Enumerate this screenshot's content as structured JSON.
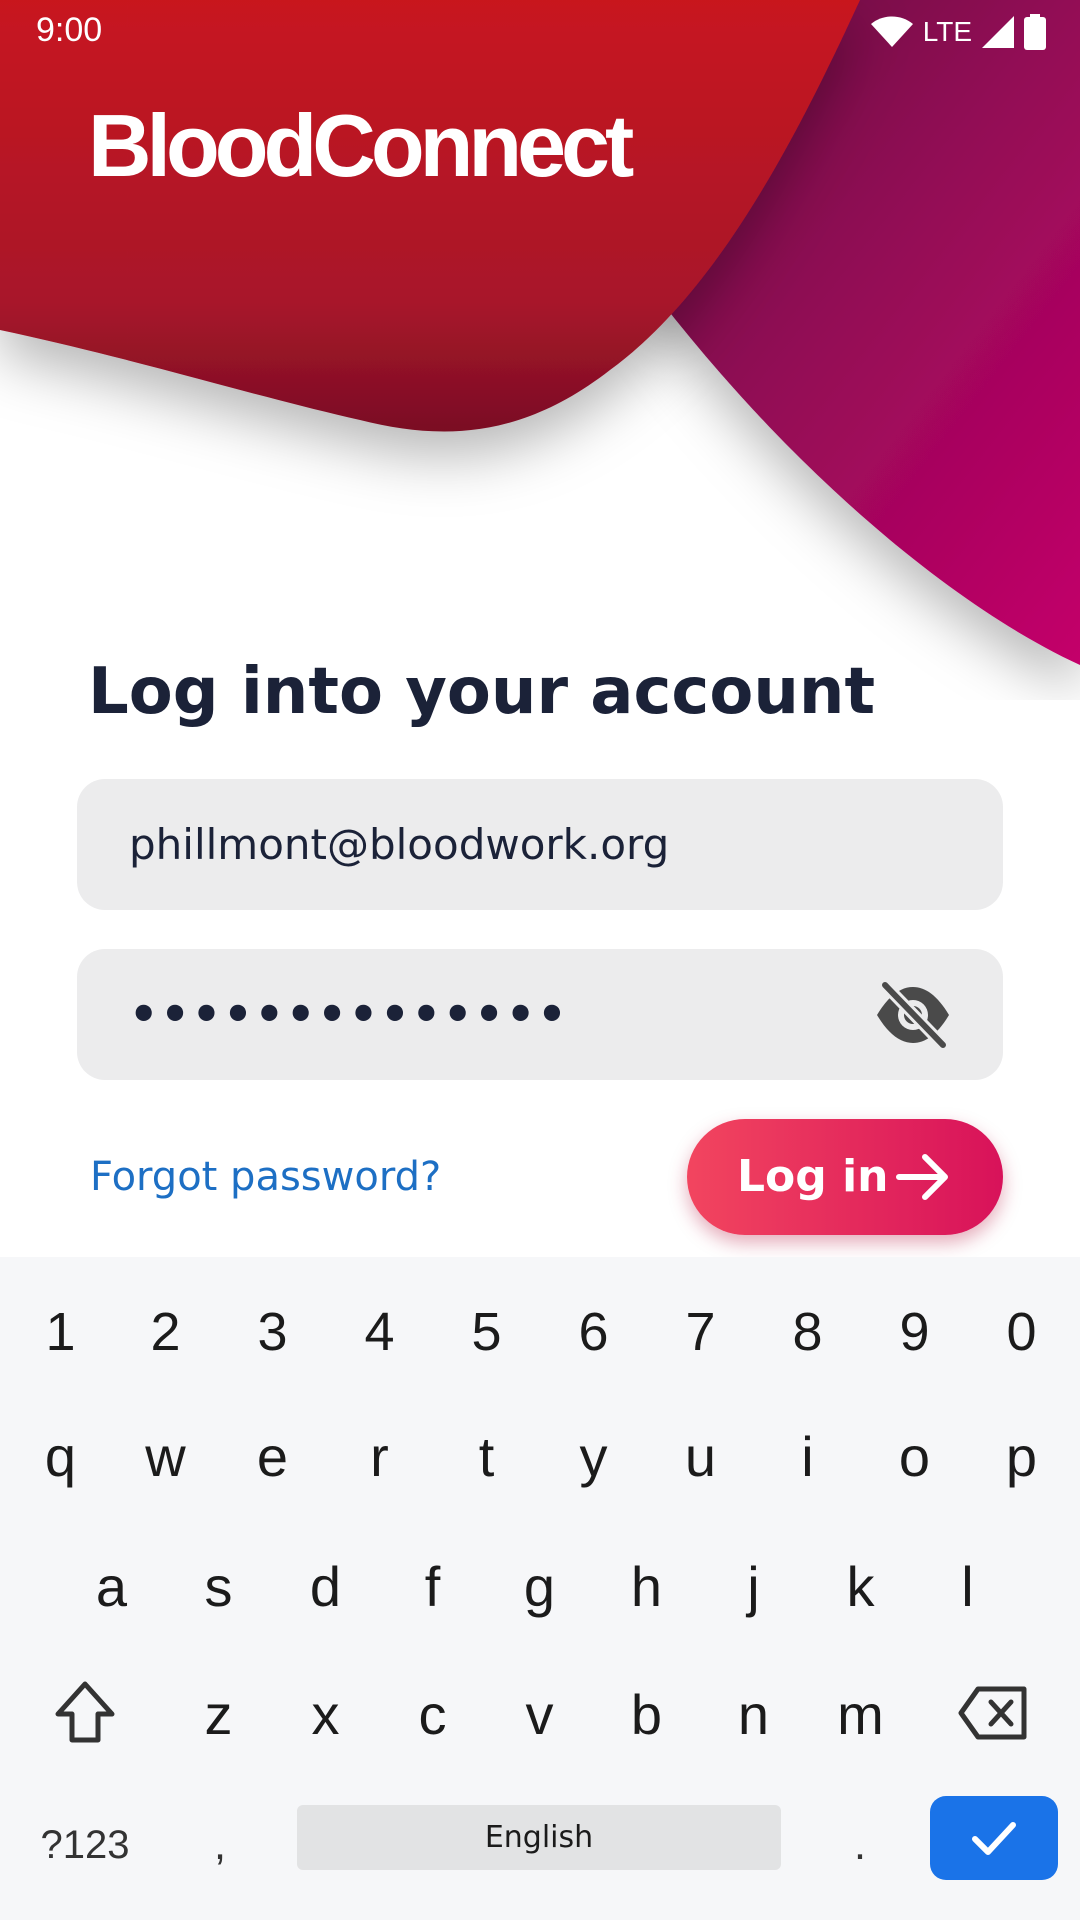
{
  "status_bar": {
    "time": "9:00",
    "network": "LTE"
  },
  "app": {
    "logo_text": "BloodConnect"
  },
  "login": {
    "title": "Log into your account",
    "email_value": "phillmont@bloodwork.org",
    "password_masked": "••••••••••••••",
    "forgot_link": "Forgot password?",
    "login_button": "Log in"
  },
  "keyboard": {
    "row_numbers": [
      "1",
      "2",
      "3",
      "4",
      "5",
      "6",
      "7",
      "8",
      "9",
      "0"
    ],
    "row_1": [
      "q",
      "w",
      "e",
      "r",
      "t",
      "y",
      "u",
      "i",
      "o",
      "p"
    ],
    "row_2": [
      "a",
      "s",
      "d",
      "f",
      "g",
      "h",
      "j",
      "k",
      "l"
    ],
    "row_3": [
      "z",
      "x",
      "c",
      "v",
      "b",
      "n",
      "m"
    ],
    "symbols_key": "?123",
    "comma_key": ",",
    "space_label": "English",
    "period_key": "."
  },
  "colors": {
    "header_red": "#c8131f",
    "header_magenta": "#c2006a",
    "title_text": "#1b2238",
    "link_blue": "#1d6fc4",
    "button_gradient_start": "#f2455f",
    "button_gradient_end": "#d8125a",
    "enter_blue": "#1a73e8"
  },
  "icons": {
    "eye_toggle": "eye-slash-icon",
    "login_arrow": "arrow-right-icon",
    "shift": "shift-arrow-icon",
    "backspace": "backspace-icon",
    "enter": "checkmark-icon"
  }
}
